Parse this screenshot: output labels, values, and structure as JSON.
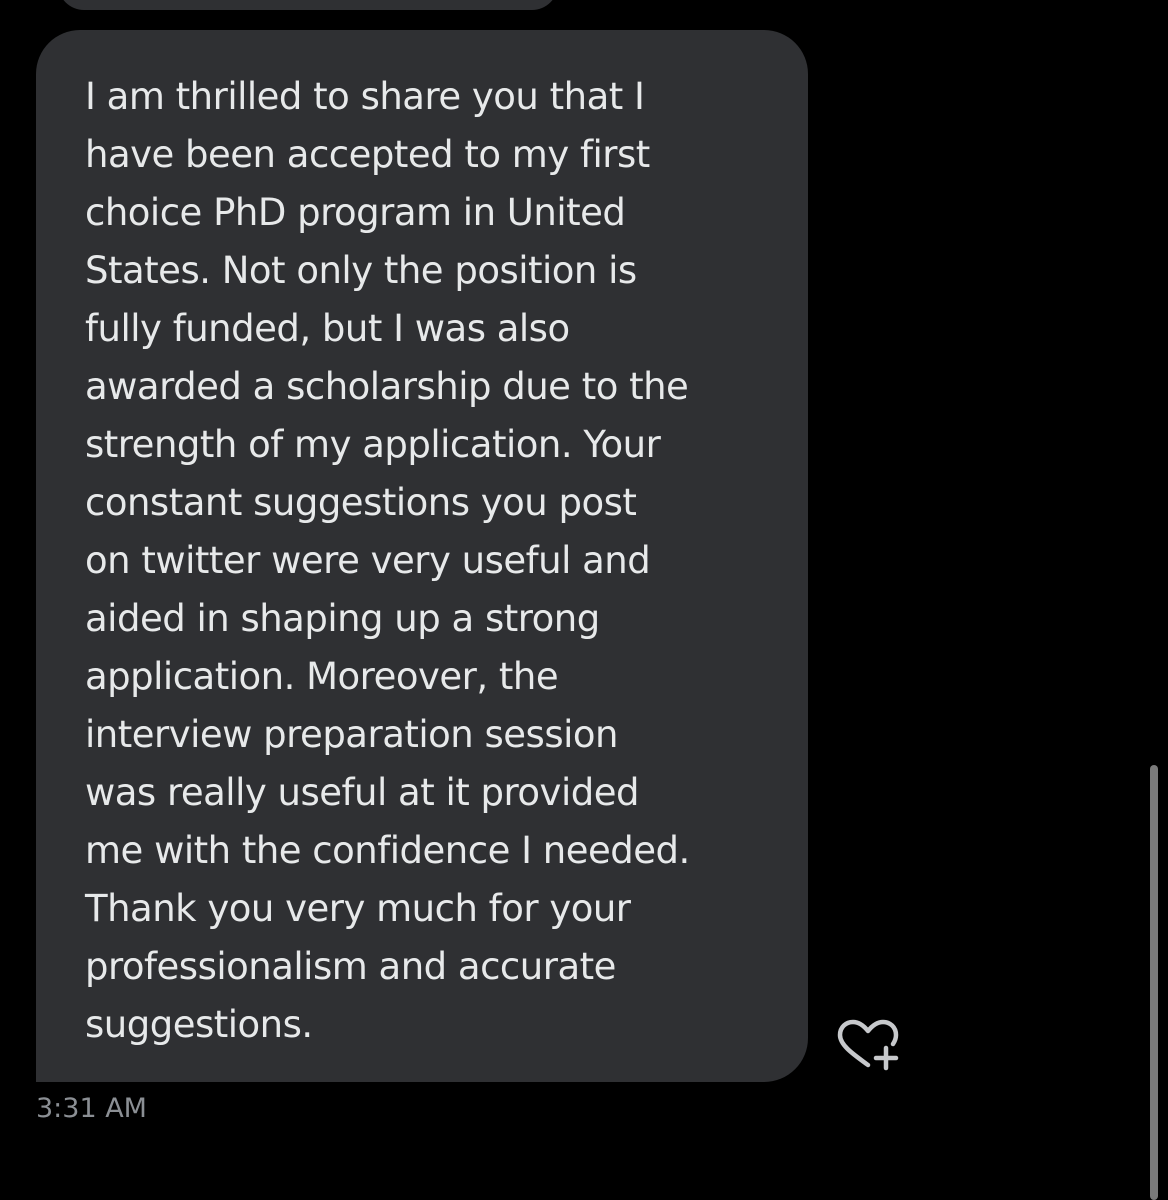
{
  "message": {
    "lines": [
      "I am thrilled to share you that I",
      "have been accepted to my first",
      "choice PhD program in United",
      "States. Not only the position is",
      "fully funded, but I was also",
      "awarded a scholarship due to the",
      "strength of my application. Your",
      "constant suggestions you post",
      "on twitter were very useful and",
      "aided in shaping up a strong",
      "application. Moreover, the",
      "interview preparation session",
      "was really useful at it provided",
      "me with the confidence I needed.",
      "Thank you very much for your",
      "professionalism and accurate",
      "suggestions."
    ],
    "timestamp": "3:31 AM"
  },
  "icons": {
    "react": "heart-plus-icon"
  },
  "colors": {
    "background": "#000000",
    "bubble": "#2f3033",
    "text": "#e7e9ea",
    "timestamp": "#8b8f94",
    "icon": "#c7c9cc"
  }
}
